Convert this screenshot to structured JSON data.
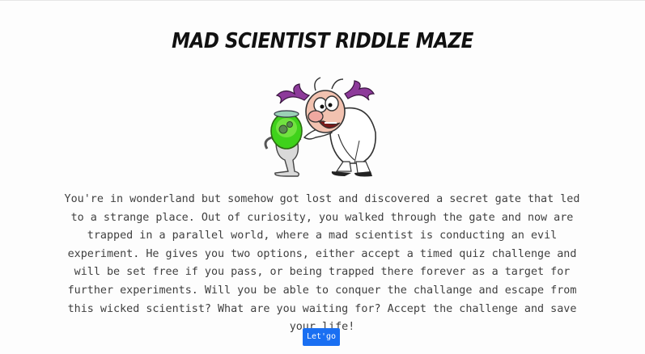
{
  "header": {
    "title": "Mad Scientist Riddle Maze"
  },
  "illustration": {
    "icon": "mad-scientist-illustration",
    "colors": {
      "potion": "#3fd21b",
      "hair": "#8d3a9a",
      "coat": "#ffffff",
      "skin": "#f2c2b0"
    }
  },
  "intro": {
    "story": "You're in wonderland but somehow got lost and discovered a secret gate that led to a strange place. Out of curiosity, you walked through the gate and now are trapped in a parallel world, where a mad scientist is conducting an evil experiment. He gives you two options, either accept a timed quiz challenge and will be set free if you pass, or being trapped there forever as a target for further experiments. Will you be able to conquer the challange and escape from this wicked scientist? What are you waiting for? Accept the challenge and save your life!"
  },
  "actions": {
    "start_label": "Let'go",
    "accent": "#1a6ff2"
  }
}
